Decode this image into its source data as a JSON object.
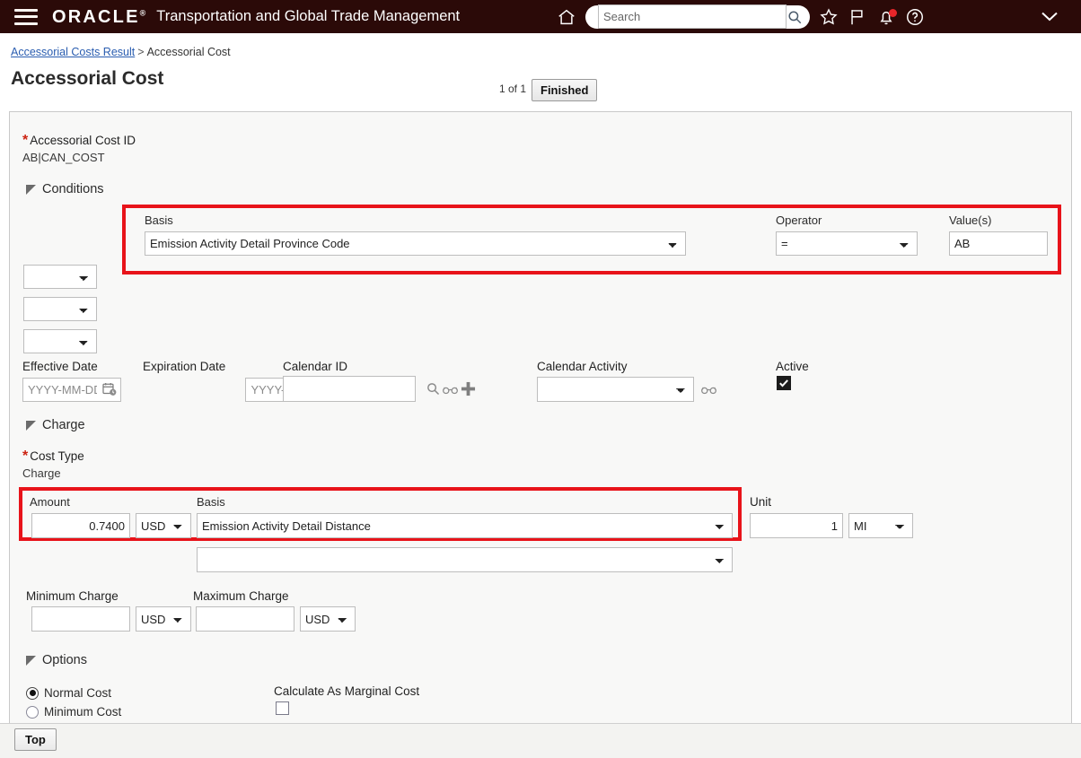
{
  "header": {
    "brand": "ORACLE",
    "brand_mark": "®",
    "app_title": "Transportation and Global Trade Management",
    "search_placeholder": "Search",
    "search_value": "",
    "icons": {
      "menu": "hamburger-icon",
      "home": "home-icon",
      "search": "search-icon",
      "favorites": "star-icon",
      "flag": "flag-icon",
      "notifications": "bell-icon",
      "help": "help-icon",
      "expand": "chevron-down-icon"
    }
  },
  "breadcrumb": {
    "link": "Accessorial Costs Result",
    "separator": ">",
    "current": "Accessorial Cost"
  },
  "page": {
    "title": "Accessorial Cost",
    "pager": "1 of 1",
    "finished_label": "Finished",
    "top_label": "Top"
  },
  "cost_id": {
    "label": "Accessorial Cost ID",
    "required": "*",
    "value": "AB|CAN_COST"
  },
  "conditions": {
    "section_label": "Conditions",
    "basis_label": "Basis",
    "basis_value": "Emission Activity Detail Province Code",
    "operator_label": "Operator",
    "operator_value": "=",
    "values_label": "Value(s)",
    "values_value": "AB",
    "extra_selects": [
      "",
      "",
      ""
    ]
  },
  "dates": {
    "effective_label": "Effective Date",
    "effective_placeholder": "YYYY-MM-DD",
    "effective_value": "",
    "expiration_label": "Expiration Date",
    "expiration_placeholder": "YYYY-MM-DD",
    "expiration_value": "",
    "calendar_id_label": "Calendar ID",
    "calendar_id_value": "",
    "calendar_activity_label": "Calendar Activity",
    "calendar_activity_value": "",
    "active_label": "Active",
    "active_checked": true
  },
  "charge": {
    "section_label": "Charge",
    "cost_type_label": "Cost Type",
    "cost_type_required": "*",
    "cost_type_value": "Charge",
    "amount_label": "Amount",
    "amount_value": "0.7400",
    "amount_currency": "USD",
    "basis_label": "Basis",
    "basis_value": "Emission Activity Detail Distance",
    "basis_secondary_value": "",
    "unit_label": "Unit",
    "unit_value": "1",
    "unit_uom": "MI",
    "minimum_label": "Minimum Charge",
    "minimum_value": "",
    "minimum_currency": "USD",
    "maximum_label": "Maximum Charge",
    "maximum_value": "",
    "maximum_currency": "USD"
  },
  "options": {
    "section_label": "Options",
    "normal_cost_label": "Normal Cost",
    "normal_cost_selected": true,
    "minimum_cost_label": "Minimum Cost",
    "minimum_cost_selected": false,
    "marginal_label": "Calculate As Marginal Cost",
    "marginal_checked": false
  },
  "colors": {
    "header_bg": "#2b0a08",
    "highlight": "#e8131a",
    "link": "#2a5db0",
    "required": "#cc2211"
  }
}
